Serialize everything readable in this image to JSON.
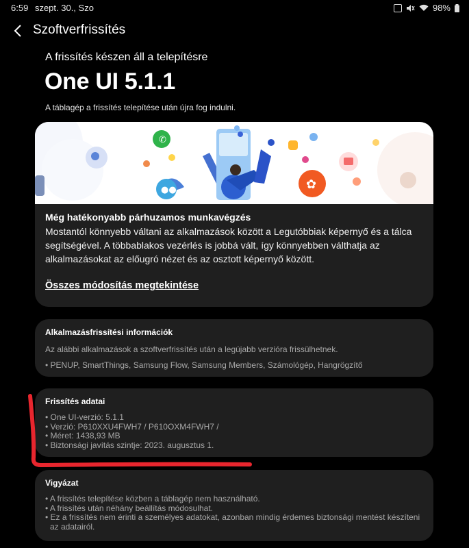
{
  "status_bar": {
    "time": "6:59",
    "date": "szept. 30., Szo",
    "battery": "98%"
  },
  "header": {
    "title": "Szoftverfrissítés"
  },
  "update": {
    "ready_text": "A frissítés készen áll a telepítésre",
    "version_name": "One UI 5.1.1",
    "restart_note": "A táblagép a frissítés telepítése után újra fog indulni."
  },
  "feature_card": {
    "title": "Még hatékonyabb párhuzamos munkavégzés",
    "body": "Mostantól könnyebb váltani az alkalmazások között a Legutóbbiak képernyő és a tálca segítségével. A többablakos vezérlés is jobbá vált, így könnyebben válthatja az alkalmazásokat az előugró nézet és az osztott képernyő között.",
    "link": "Összes módosítás megtekintése"
  },
  "app_updates": {
    "title": "Alkalmazásfrissítési információk",
    "description": "Az alábbi alkalmazások a szoftverfrissítés után a legújabb verzióra frissülhetnek.",
    "apps": "• PENUP, SmartThings, Samsung Flow, Samsung Members, Számológép, Hangrögzítő"
  },
  "update_details": {
    "title": "Frissítés adatai",
    "items": [
      "• One UI-verzió: 5.1.1",
      "• Verzió: P610XXU4FWH7 / P610OXM4FWH7 /",
      "• Méret: 1438,93 MB",
      "• Biztonsági javítás szintje: 2023. augusztus 1."
    ]
  },
  "caution": {
    "title": "Vigyázat",
    "items": [
      "• A frissítés telepítése közben a táblagép nem használható.",
      "• A frissítés után néhány beállítás módosulhat.",
      "• Ez a frissítés nem érinti a személyes adatokat, azonban mindig érdemes biztonsági mentést készíteni az adatairól."
    ]
  },
  "colors": {
    "background": "#000000",
    "card": "#1f1f1f",
    "annotation": "#e8262e"
  }
}
